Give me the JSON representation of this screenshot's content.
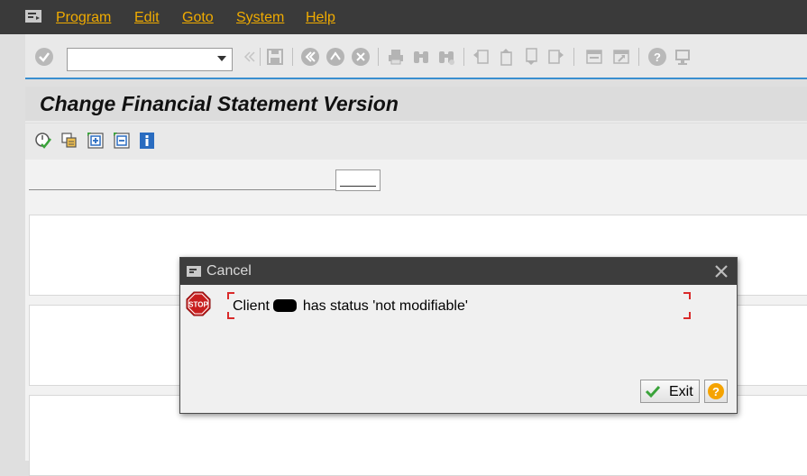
{
  "menu": {
    "items": [
      {
        "label": "Program"
      },
      {
        "label": "Edit"
      },
      {
        "label": "Goto"
      },
      {
        "label": "System"
      },
      {
        "label": "Help"
      }
    ]
  },
  "toolbar": {
    "command_field_value": ""
  },
  "screen": {
    "title": "Change Financial Statement Version"
  },
  "dialog": {
    "title": "Cancel",
    "message_prefix": "Client",
    "message_suffix": "has status 'not modifiable'",
    "stop_icon_text": "STOP",
    "exit_label": "Exit"
  },
  "colors": {
    "menu_text": "#f0ab00",
    "menubar_bg": "#3a3a3a",
    "accent_line": "#3a8fd0",
    "stop_red": "#c81e1e",
    "help_orange": "#f5a300",
    "check_green": "#3aa33a"
  }
}
